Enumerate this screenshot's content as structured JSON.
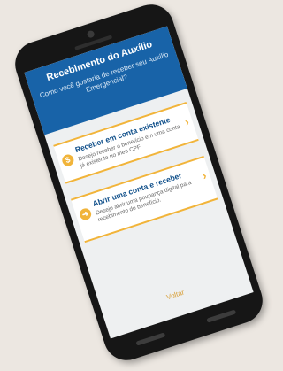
{
  "header": {
    "title": "Recebimento do Auxílio",
    "subtitle": "Como você gostaria de receber seu Auxílio Emergencial?"
  },
  "options": [
    {
      "icon": "dollar-icon",
      "icon_glyph": "$",
      "title": "Receber em conta existente",
      "description": "Desejo receber o benefício em uma conta já existente no meu CPF."
    },
    {
      "icon": "arrow-right-icon",
      "icon_glyph": "➜",
      "title": "Abrir uma conta e receber",
      "description": "Desejo abrir uma poupança digital para recebimento do benefício."
    }
  ],
  "chevron_glyph": "›",
  "footer": {
    "back_label": "Voltar"
  },
  "colors": {
    "header_blue": "#1863a8",
    "accent_orange": "#f1b43a",
    "title_blue": "#0f4f8a"
  }
}
